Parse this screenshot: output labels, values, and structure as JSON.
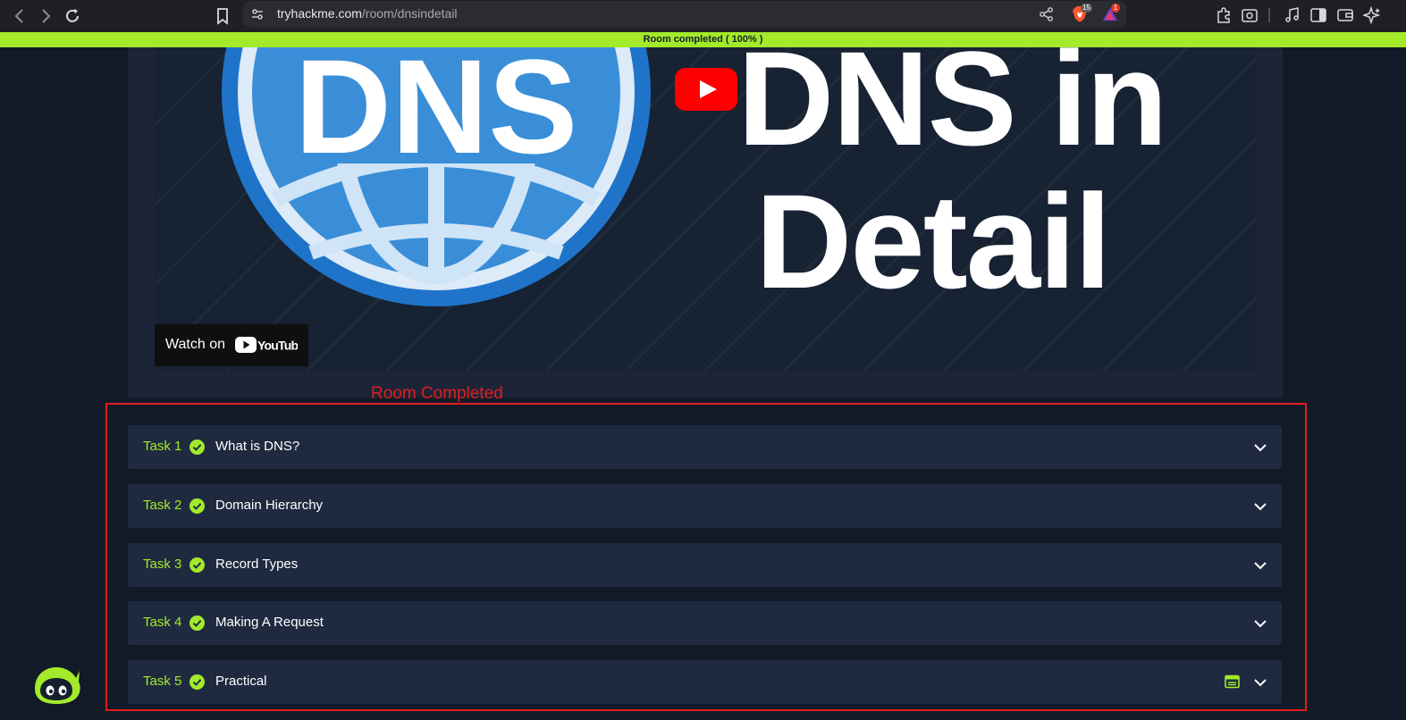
{
  "browser": {
    "url_host": "tryhackme.com",
    "url_path": "/room/dnsindetail",
    "shields_badge": "15",
    "rewards_badge": "1",
    "icons": [
      "back-icon",
      "forward-icon",
      "reload-icon",
      "bookmark-icon",
      "site-info-icon",
      "share-icon",
      "brave-shield-icon",
      "brave-rewards-icon",
      "extensions-icon",
      "screenshot-icon",
      "media-icon",
      "sidebar-icon",
      "wallet-icon",
      "leo-ai-icon"
    ]
  },
  "progress": {
    "label": "Room completed ( 100% )",
    "value": 1.0,
    "color": "#a3ea2a"
  },
  "video": {
    "title_line1": "DNS in",
    "title_line2": "Detail",
    "globe_text": "DNS",
    "watch_label": "Watch on",
    "youtube_label": "YouTube"
  },
  "annotation": {
    "label": "Room Completed",
    "color": "#e01d1d"
  },
  "tasks": [
    {
      "number": "Task 1",
      "title": "What is DNS?",
      "completed": true
    },
    {
      "number": "Task 2",
      "title": "Domain Hierarchy",
      "completed": true
    },
    {
      "number": "Task 3",
      "title": "Record Types",
      "completed": true
    },
    {
      "number": "Task 4",
      "title": "Making A Request",
      "completed": true
    },
    {
      "number": "Task 5",
      "title": "Practical",
      "completed": true,
      "has_vm_icon": true
    }
  ],
  "colors": {
    "accent": "#a3ea2a",
    "background": "#131a27",
    "task_bg": "#1f2a40"
  }
}
